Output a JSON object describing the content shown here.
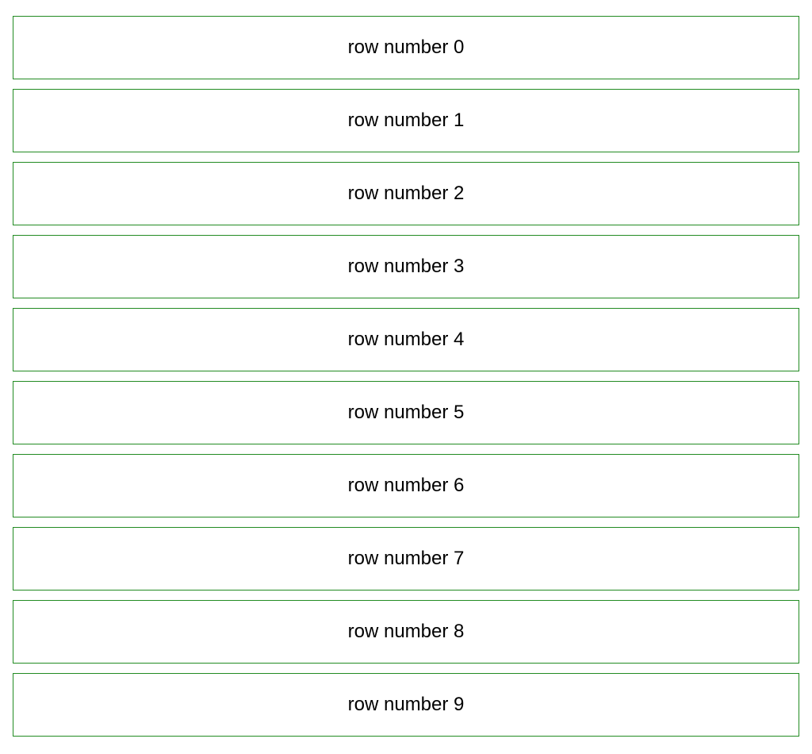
{
  "rows": [
    {
      "label": "row number 0"
    },
    {
      "label": "row number 1"
    },
    {
      "label": "row number 2"
    },
    {
      "label": "row number 3"
    },
    {
      "label": "row number 4"
    },
    {
      "label": "row number 5"
    },
    {
      "label": "row number 6"
    },
    {
      "label": "row number 7"
    },
    {
      "label": "row number 8"
    },
    {
      "label": "row number 9"
    }
  ],
  "colors": {
    "border": "#228B22",
    "text": "#000000",
    "background": "#ffffff"
  }
}
